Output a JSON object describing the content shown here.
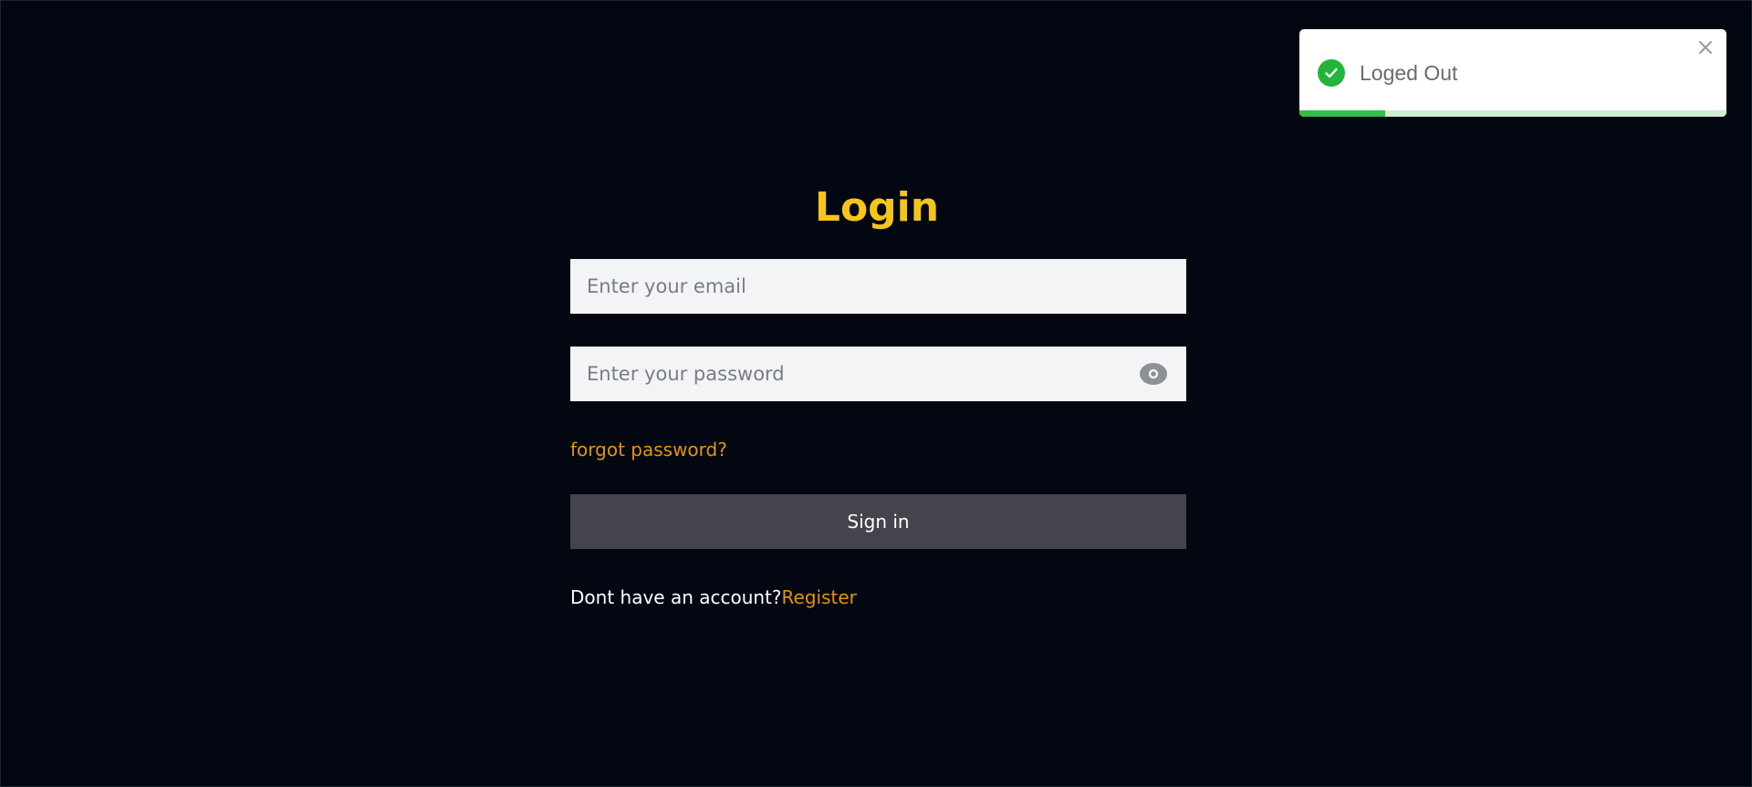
{
  "toast": {
    "message": "Loged Out",
    "status": "success",
    "icon": "check-circle-icon",
    "close_icon": "close-icon",
    "progress": 0.2,
    "colors": {
      "success": "#22b53a",
      "progress_fill": "#33c148",
      "progress_track": "#cdeed3"
    }
  },
  "login": {
    "title": "Login",
    "email": {
      "value": "",
      "placeholder": "Enter your email"
    },
    "password": {
      "value": "",
      "placeholder": "Enter your password",
      "toggle_icon": "eye-icon"
    },
    "forgot_password_label": "forgot password?",
    "sign_in_label": "Sign in",
    "register_prompt": "Dont have an account?",
    "register_label": "Register"
  },
  "colors": {
    "background": "#030712",
    "title": "#f5c518",
    "link": "#e0960c",
    "button": "#44444c",
    "input_background": "#f3f4f6"
  }
}
